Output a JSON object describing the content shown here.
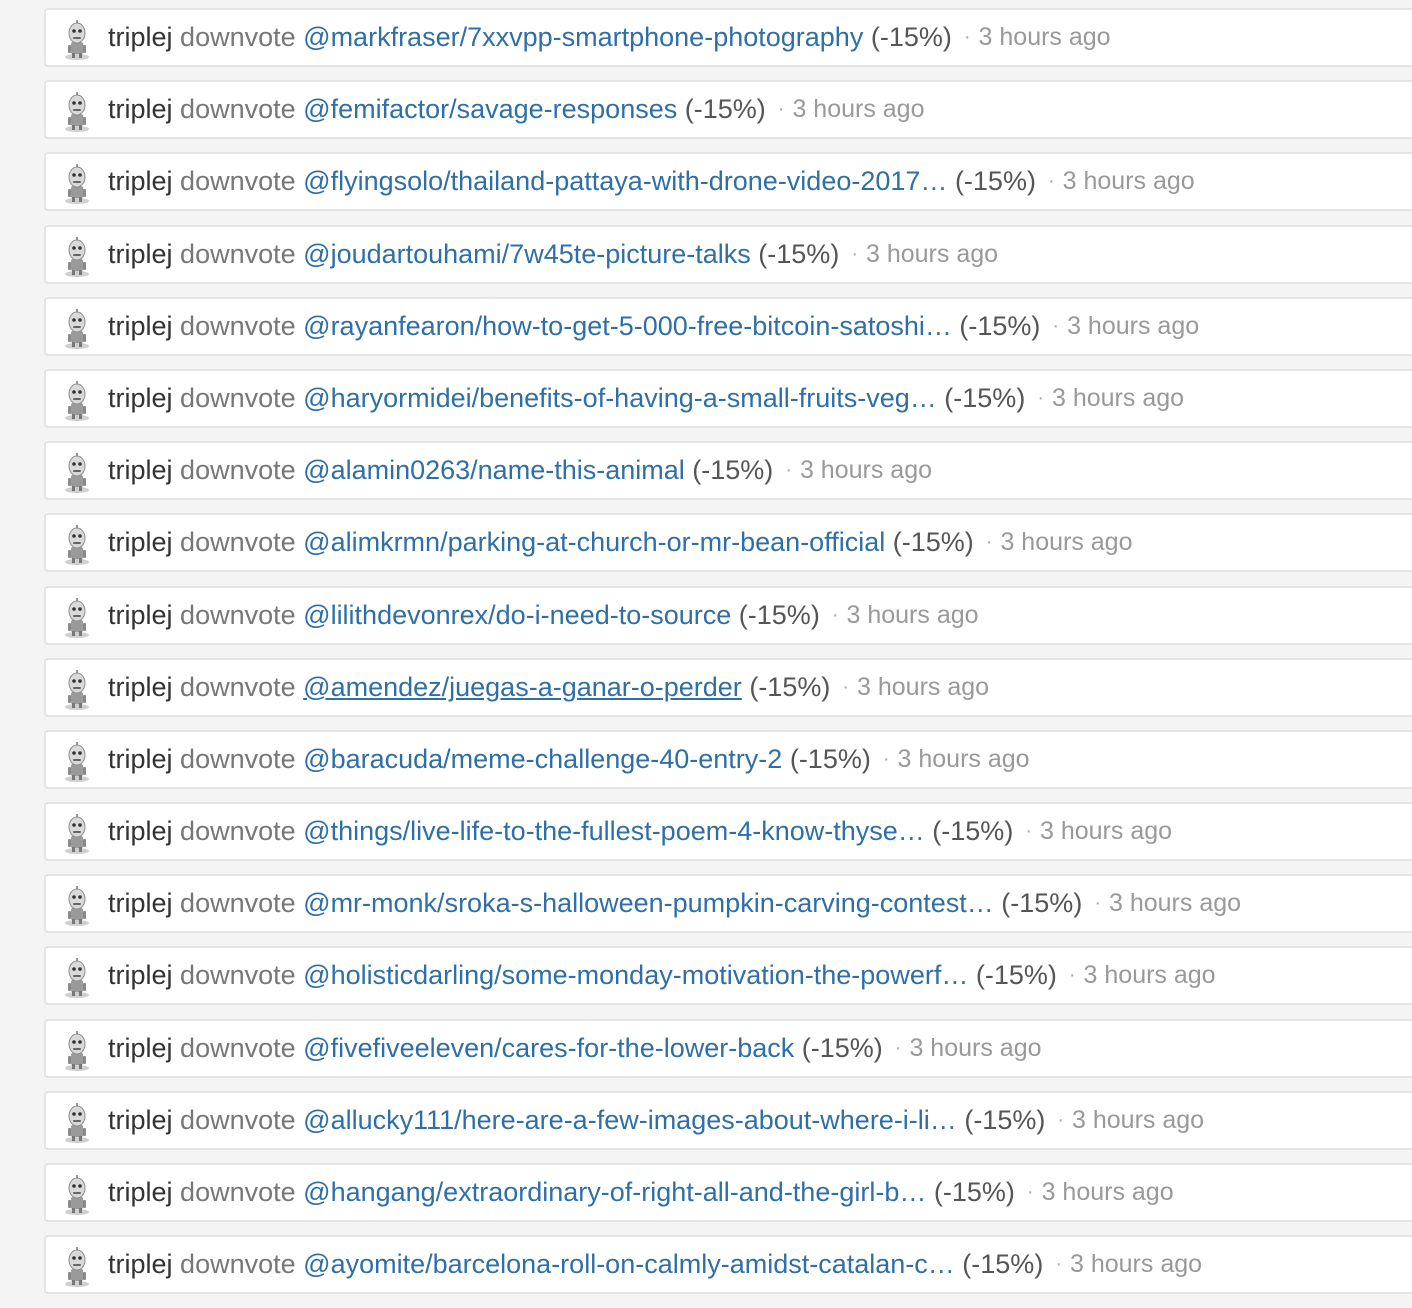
{
  "feed": {
    "items": [
      {
        "user": "triplej",
        "action": "downvote",
        "permlink": "@markfraser/7xxvpp-smartphone-photography",
        "percent": "(-15%)",
        "separator": "·",
        "time": "3 hours ago"
      },
      {
        "user": "triplej",
        "action": "downvote",
        "permlink": "@femifactor/savage-responses",
        "percent": "(-15%)",
        "separator": "·",
        "time": "3 hours ago"
      },
      {
        "user": "triplej",
        "action": "downvote",
        "permlink": "@flyingsolo/thailand-pattaya-with-drone-video-2017…",
        "percent": "(-15%)",
        "separator": "·",
        "time": "3 hours ago"
      },
      {
        "user": "triplej",
        "action": "downvote",
        "permlink": "@joudartouhami/7w45te-picture-talks",
        "percent": "(-15%)",
        "separator": "·",
        "time": "3 hours ago"
      },
      {
        "user": "triplej",
        "action": "downvote",
        "permlink": "@rayanfearon/how-to-get-5-000-free-bitcoin-satoshi…",
        "percent": "(-15%)",
        "separator": "·",
        "time": "3 hours ago"
      },
      {
        "user": "triplej",
        "action": "downvote",
        "permlink": "@haryormidei/benefits-of-having-a-small-fruits-veg…",
        "percent": "(-15%)",
        "separator": "·",
        "time": "3 hours ago"
      },
      {
        "user": "triplej",
        "action": "downvote",
        "permlink": "@alamin0263/name-this-animal",
        "percent": "(-15%)",
        "separator": "·",
        "time": "3 hours ago"
      },
      {
        "user": "triplej",
        "action": "downvote",
        "permlink": "@alimkrmn/parking-at-church-or-mr-bean-official",
        "percent": "(-15%)",
        "separator": "·",
        "time": "3 hours ago"
      },
      {
        "user": "triplej",
        "action": "downvote",
        "permlink": "@lilithdevonrex/do-i-need-to-source",
        "percent": "(-15%)",
        "separator": "·",
        "time": "3 hours ago"
      },
      {
        "user": "triplej",
        "action": "downvote",
        "permlink": "@amendez/juegas-a-ganar-o-perder",
        "percent": "(-15%)",
        "separator": "·",
        "time": "3 hours ago",
        "hovered": true
      },
      {
        "user": "triplej",
        "action": "downvote",
        "permlink": "@baracuda/meme-challenge-40-entry-2",
        "percent": "(-15%)",
        "separator": "·",
        "time": "3 hours ago"
      },
      {
        "user": "triplej",
        "action": "downvote",
        "permlink": "@things/live-life-to-the-fullest-poem-4-know-thyse…",
        "percent": "(-15%)",
        "separator": "·",
        "time": "3 hours ago"
      },
      {
        "user": "triplej",
        "action": "downvote",
        "permlink": "@mr-monk/sroka-s-halloween-pumpkin-carving-contest…",
        "percent": "(-15%)",
        "separator": "·",
        "time": "3 hours ago"
      },
      {
        "user": "triplej",
        "action": "downvote",
        "permlink": "@holisticdarling/some-monday-motivation-the-powerf…",
        "percent": "(-15%)",
        "separator": "·",
        "time": "3 hours ago"
      },
      {
        "user": "triplej",
        "action": "downvote",
        "permlink": "@fivefiveeleven/cares-for-the-lower-back",
        "percent": "(-15%)",
        "separator": "·",
        "time": "3 hours ago"
      },
      {
        "user": "triplej",
        "action": "downvote",
        "permlink": "@allucky111/here-are-a-few-images-about-where-i-li…",
        "percent": "(-15%)",
        "separator": "·",
        "time": "3 hours ago"
      },
      {
        "user": "triplej",
        "action": "downvote",
        "permlink": "@hangang/extraordinary-of-right-all-and-the-girl-b…",
        "percent": "(-15%)",
        "separator": "·",
        "time": "3 hours ago"
      },
      {
        "user": "triplej",
        "action": "downvote",
        "permlink": "@ayomite/barcelona-roll-on-calmly-amidst-catalan-c…",
        "percent": "(-15%)",
        "separator": "·",
        "time": "3 hours ago"
      }
    ]
  },
  "colors": {
    "link": "#2f6fa8",
    "user": "#333333",
    "action": "#777777",
    "time": "#999999",
    "background": "#f4f4f4",
    "card": "#ffffff"
  },
  "icons": {
    "avatar": "robot-avatar-icon"
  }
}
